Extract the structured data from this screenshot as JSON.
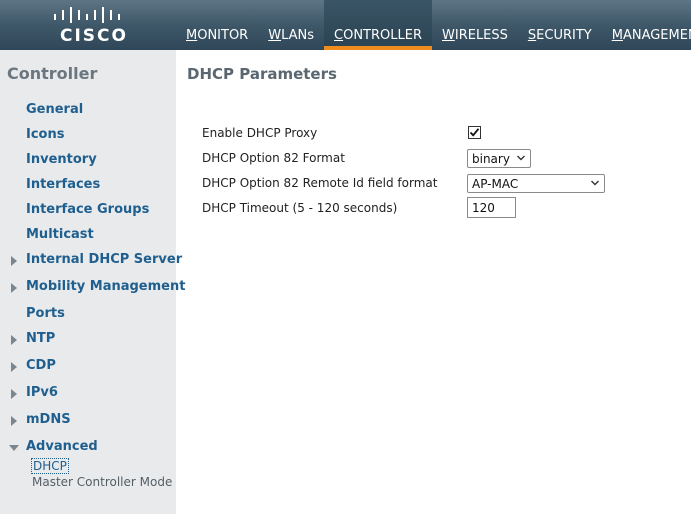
{
  "brand": {
    "logo_text": "CISCO"
  },
  "nav": {
    "items": [
      {
        "first": "M",
        "rest": "ONITOR"
      },
      {
        "first": "W",
        "rest": "LANs"
      },
      {
        "first": "C",
        "rest": "ONTROLLER"
      },
      {
        "first": "W",
        "rest": "IRELESS"
      },
      {
        "first": "S",
        "rest": "ECURITY"
      },
      {
        "first": "M",
        "rest": "ANAGEMENT"
      }
    ],
    "active": "CONTROLLER",
    "accent_color": "#f08c1e"
  },
  "sidebar": {
    "title": "Controller",
    "items": {
      "general": "General",
      "icons": "Icons",
      "inventory": "Inventory",
      "interfaces": "Interfaces",
      "interface_groups": "Interface Groups",
      "multicast": "Multicast",
      "internal_dhcp_server": "Internal DHCP Server",
      "mobility_management": "Mobility Management",
      "ports": "Ports",
      "ntp": "NTP",
      "cdp": "CDP",
      "ipv6": "IPv6",
      "mdns": "mDNS",
      "advanced": "Advanced"
    },
    "sub_items": {
      "dhcp": "DHCP",
      "master_controller_mode": "Master Controller Mode"
    }
  },
  "main": {
    "title": "DHCP Parameters",
    "fields": {
      "enable_proxy_label": "Enable DHCP Proxy",
      "enable_proxy_checked": true,
      "option82_format_label": "DHCP Option 82 Format",
      "option82_format_value": "binary",
      "option82_remote_id_label": "DHCP Option 82 Remote Id field format",
      "option82_remote_id_value": "AP-MAC",
      "timeout_label": "DHCP Timeout (5 - 120 seconds)",
      "timeout_value": "120"
    }
  }
}
